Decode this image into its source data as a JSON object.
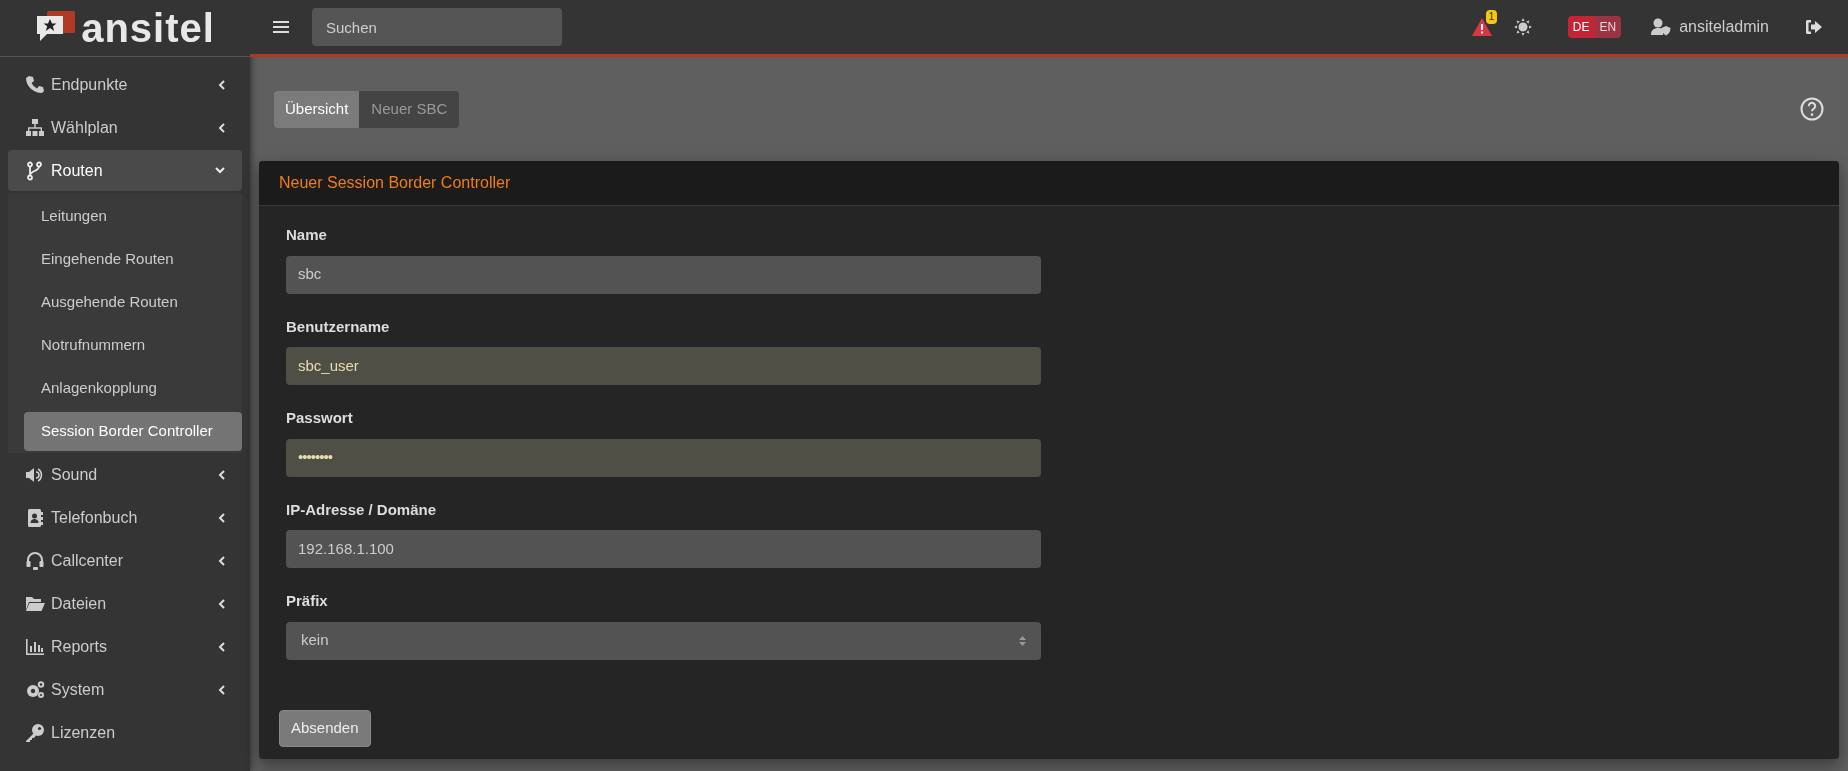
{
  "brand": {
    "name": "ansitel"
  },
  "topbar": {
    "search": {
      "placeholder": "Suchen"
    },
    "alerts": {
      "count": "1"
    },
    "languages": [
      {
        "label": "DE",
        "selected": true
      },
      {
        "label": "EN",
        "selected": false
      }
    ],
    "user": "ansiteladmin"
  },
  "sidebar": {
    "items": [
      {
        "label": "Endpunkte",
        "expanded": false
      },
      {
        "label": "Wählplan",
        "expanded": false
      },
      {
        "label": "Routen",
        "expanded": true,
        "children": [
          {
            "label": "Leitungen",
            "selected": false
          },
          {
            "label": "Eingehende Routen",
            "selected": false
          },
          {
            "label": "Ausgehende Routen",
            "selected": false
          },
          {
            "label": "Notrufnummern",
            "selected": false
          },
          {
            "label": "Anlagenkopplung",
            "selected": false
          },
          {
            "label": "Session Border Controller",
            "selected": true
          }
        ]
      },
      {
        "label": "Sound",
        "expanded": false
      },
      {
        "label": "Telefonbuch",
        "expanded": false
      },
      {
        "label": "Callcenter",
        "expanded": false
      },
      {
        "label": "Dateien",
        "expanded": false
      },
      {
        "label": "Reports",
        "expanded": false
      },
      {
        "label": "System",
        "expanded": false
      },
      {
        "label": "Lizenzen"
      }
    ]
  },
  "tabs": [
    {
      "label": "Übersicht",
      "selected": true
    },
    {
      "label": "Neuer SBC",
      "selected": false
    }
  ],
  "card": {
    "title": "Neuer Session Border Controller",
    "fields": [
      {
        "kind": "text",
        "label": "Name",
        "value": "sbc",
        "autofilled": false
      },
      {
        "kind": "text",
        "label": "Benutzername",
        "value": "sbc_user",
        "autofilled": true
      },
      {
        "kind": "password",
        "label": "Passwort",
        "value": "••••••••",
        "autofilled": true
      },
      {
        "kind": "text",
        "label": "IP-Adresse / Domäne",
        "value": "192.168.1.100",
        "autofilled": false
      },
      {
        "kind": "select",
        "label": "Präfix",
        "value": "kein",
        "autofilled": false
      }
    ],
    "submit": "Absenden"
  }
}
